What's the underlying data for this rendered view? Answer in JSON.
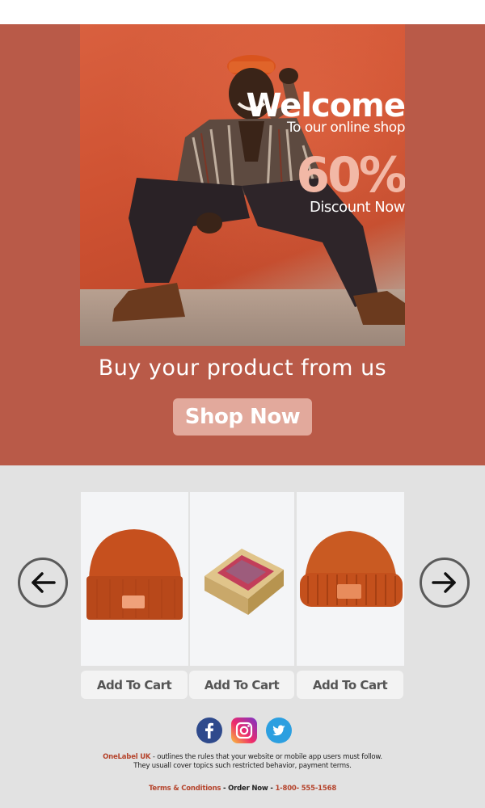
{
  "hero": {
    "welcome": "Welcome",
    "welcome_sub": "To our online shop",
    "discount": "60%",
    "discount_sub": "Discount Now",
    "tagline": "Buy your product from us",
    "shop_button": "Shop Now"
  },
  "products": [
    {
      "name": "orange-beanie",
      "button": "Add To Cart"
    },
    {
      "name": "boxed-beanie",
      "button": "Add To Cart"
    },
    {
      "name": "ribbed-beanie",
      "button": "Add To Cart"
    }
  ],
  "footer": {
    "brand": "OneLabel UK",
    "line1": " - outlines the rules that your website or mobile app users must follow.",
    "line2": "They usuall cover topics such restricted behavior, payment terms.",
    "terms": "Terms & Conditions",
    "sep1": " - ",
    "order": "Order Now",
    "sep2": " - ",
    "phone": "1-800- 555-1568"
  },
  "colors": {
    "hero_bg": "#b95a48",
    "accent": "#b5442c",
    "button_bg": "#e2a99c",
    "section_bg": "#e2e2e2"
  },
  "icons": [
    "arrow-left-icon",
    "arrow-right-icon",
    "facebook-icon",
    "instagram-icon",
    "twitter-icon"
  ]
}
